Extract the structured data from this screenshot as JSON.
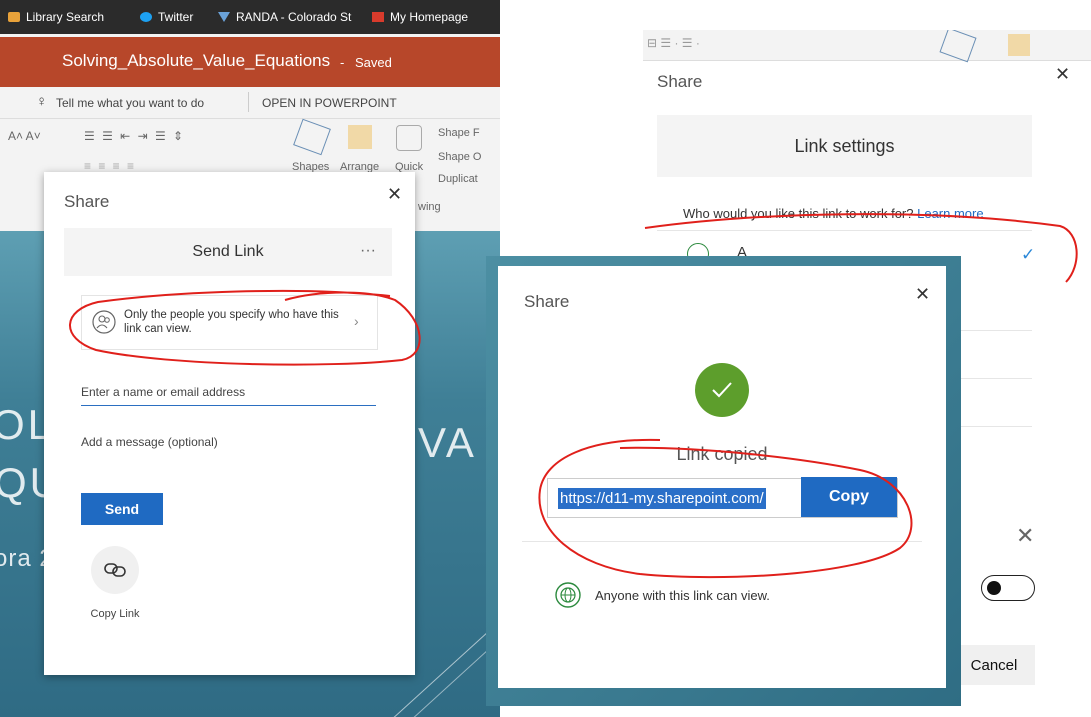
{
  "bookmarks": [
    "Library Search",
    "Twitter",
    "RANDA - Colorado St",
    "My Homepage"
  ],
  "powerpoint": {
    "doc_title": "Solving_Absolute_Value_Equations",
    "status": "Saved",
    "tell_me": "Tell me what you want to do",
    "open_in": "OPEN IN POWERPOINT",
    "ribbon": {
      "shapes": "Shapes",
      "arrange": "Arrange",
      "quick": "Quick",
      "shape_fill": "Shape F",
      "shape_outline": "Shape O",
      "duplicate": "Duplicat",
      "drawing": "wing"
    },
    "slide_fragments": [
      "OLV",
      "VA",
      "QU",
      "ora 2",
      "2",
      "V",
      "U"
    ]
  },
  "share_dialog": {
    "title": "Share",
    "tab_label": "Send Link",
    "more": "···",
    "permission_text": "Only the people you specify who have this link can view.",
    "email_placeholder": "Enter a name or email address",
    "message_placeholder": "Add a message (optional)",
    "send_label": "Send",
    "copy_link_label": "Copy Link"
  },
  "link_settings": {
    "title": "Share",
    "header": "Link settings",
    "question": "Who would you like this link to work for?",
    "learn_more": "Learn more",
    "first_option": "A",
    "cancel_label": "Cancel"
  },
  "link_copied_dialog": {
    "title": "Share",
    "message": "Link copied",
    "url": "https://d11-my.sharepoint.com/",
    "copy_label": "Copy",
    "scope_text": "Anyone with this link can view."
  },
  "colors": {
    "powerpoint_red": "#b7472a",
    "accent_blue": "#1f6ac2",
    "success_green": "#5d9e2c",
    "annotation_red": "#e0201b"
  }
}
